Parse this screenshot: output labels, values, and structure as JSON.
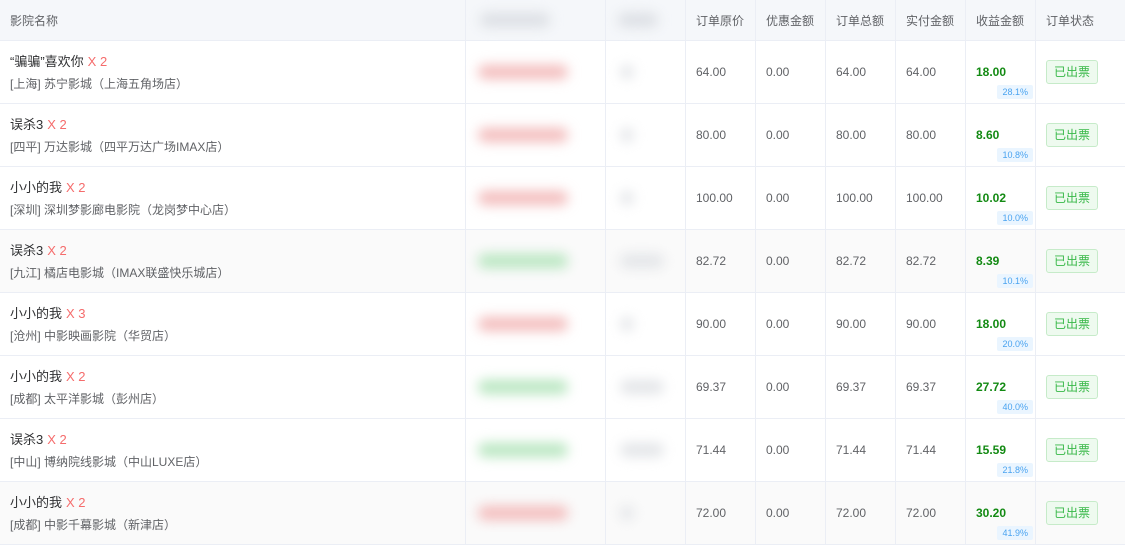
{
  "headers": {
    "name": "影院名称",
    "orig": "订单原价",
    "discount": "优惠金额",
    "total": "订单总额",
    "paid": "实付金额",
    "profit": "收益金额",
    "status": "订单状态"
  },
  "colors": {
    "profit": "#138a13",
    "qty": "#f56c6c",
    "tag_text": "#38b848",
    "pct_text": "#4aa3f0"
  },
  "rows": [
    {
      "movie": "“骗骗”喜欢你",
      "qty": "X 2",
      "cinema": "[上海] 苏宁影城（上海五角场店）",
      "orig": "64.00",
      "discount": "0.00",
      "total": "64.00",
      "paid": "64.00",
      "profit": "18.00",
      "pct": "28.1%",
      "status": "已出票",
      "blur": "red"
    },
    {
      "movie": "误杀3",
      "qty": "X 2",
      "cinema": "[四平] 万达影城（四平万达广场IMAX店）",
      "orig": "80.00",
      "discount": "0.00",
      "total": "80.00",
      "paid": "80.00",
      "profit": "8.60",
      "pct": "10.8%",
      "status": "已出票",
      "blur": "red"
    },
    {
      "movie": "小小的我",
      "qty": "X 2",
      "cinema": "[深圳] 深圳梦影廊电影院（龙岗梦中心店）",
      "orig": "100.00",
      "discount": "0.00",
      "total": "100.00",
      "paid": "100.00",
      "profit": "10.02",
      "pct": "10.0%",
      "status": "已出票",
      "blur": "red"
    },
    {
      "movie": "误杀3",
      "qty": "X 2",
      "cinema": "[九江] 橘店电影城（IMAX联盛快乐城店）",
      "orig": "82.72",
      "discount": "0.00",
      "total": "82.72",
      "paid": "82.72",
      "profit": "8.39",
      "pct": "10.1%",
      "status": "已出票",
      "blur": "green"
    },
    {
      "movie": "小小的我",
      "qty": "X 3",
      "cinema": "[沧州] 中影映画影院（华贸店）",
      "orig": "90.00",
      "discount": "0.00",
      "total": "90.00",
      "paid": "90.00",
      "profit": "18.00",
      "pct": "20.0%",
      "status": "已出票",
      "blur": "red"
    },
    {
      "movie": "小小的我",
      "qty": "X 2",
      "cinema": "[成都] 太平洋影城（彭州店）",
      "orig": "69.37",
      "discount": "0.00",
      "total": "69.37",
      "paid": "69.37",
      "profit": "27.72",
      "pct": "40.0%",
      "status": "已出票",
      "blur": "green"
    },
    {
      "movie": "误杀3",
      "qty": "X 2",
      "cinema": "[中山] 博纳院线影城（中山LUXE店）",
      "orig": "71.44",
      "discount": "0.00",
      "total": "71.44",
      "paid": "71.44",
      "profit": "15.59",
      "pct": "21.8%",
      "status": "已出票",
      "blur": "green"
    },
    {
      "movie": "小小的我",
      "qty": "X 2",
      "cinema": "[成都] 中影千幕影城（新津店）",
      "orig": "72.00",
      "discount": "0.00",
      "total": "72.00",
      "paid": "72.00",
      "profit": "30.20",
      "pct": "41.9%",
      "status": "已出票",
      "blur": "red"
    }
  ]
}
